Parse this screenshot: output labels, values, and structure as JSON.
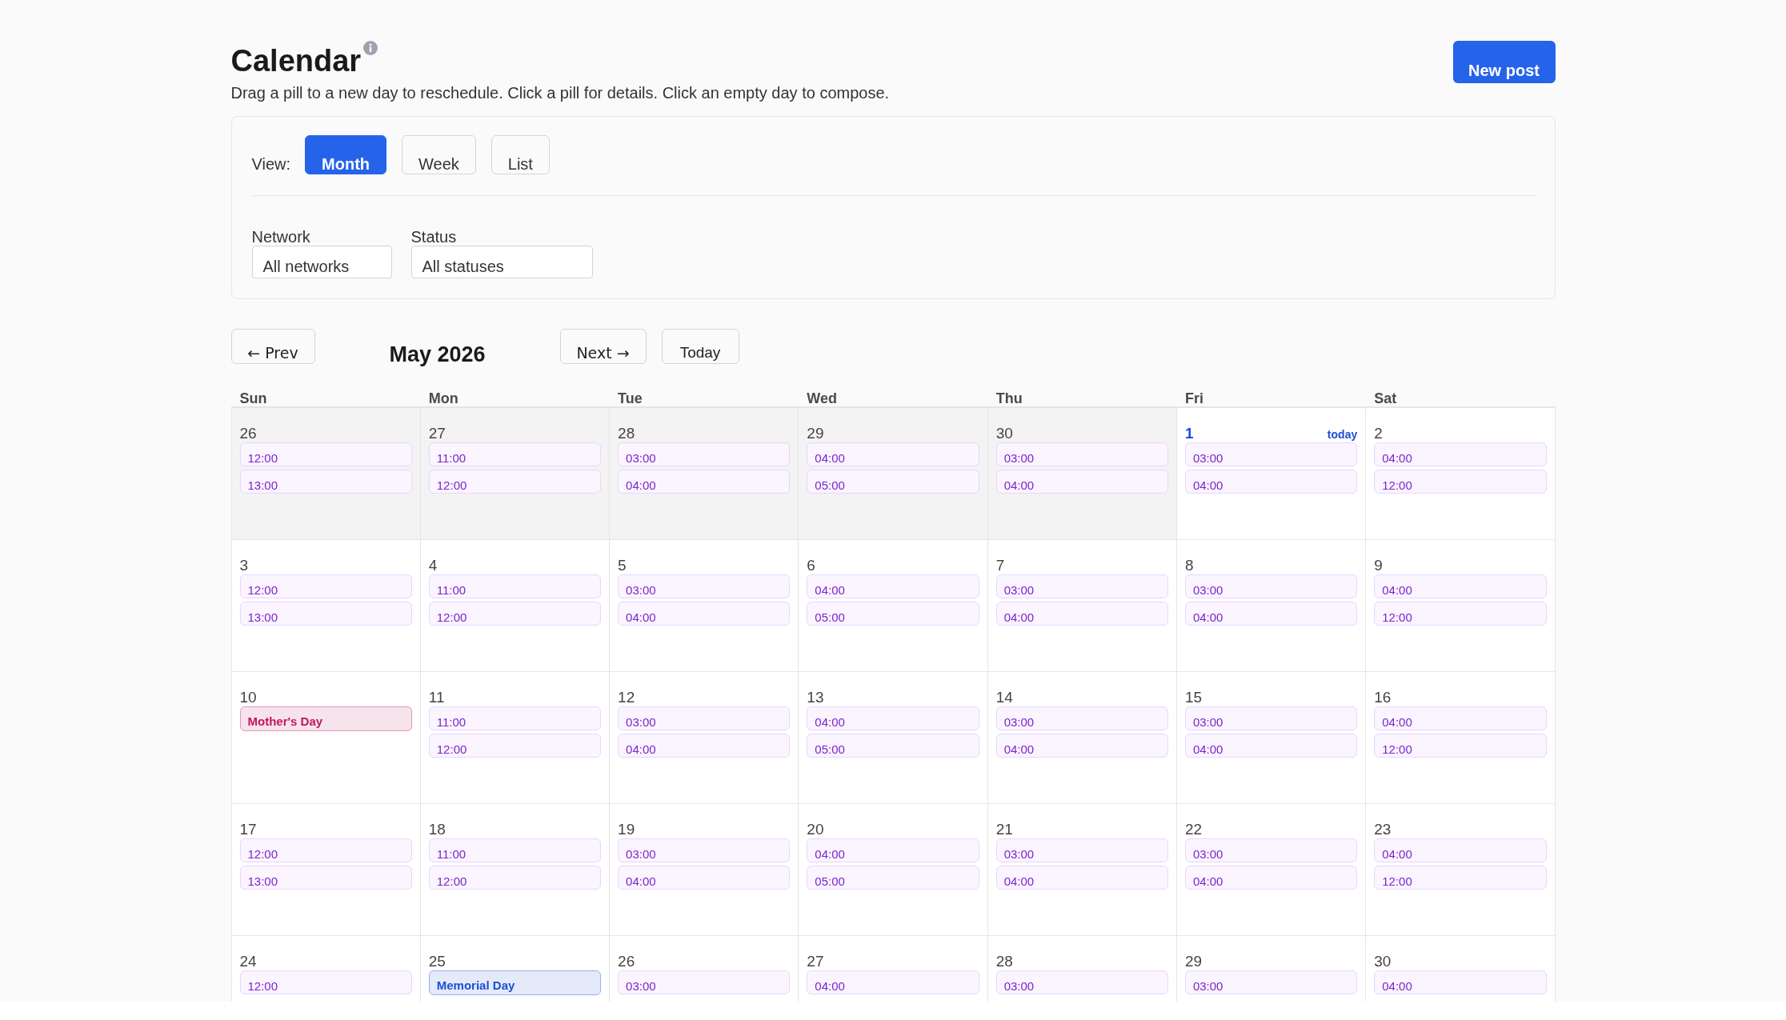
{
  "header": {
    "title": "Calendar",
    "subtitle": "Drag a pill to a new day to reschedule. Click a pill for details. Click an empty day to compose.",
    "new_post_button": "New post"
  },
  "filters": {
    "view_label": "View:",
    "views": [
      {
        "label": "Month",
        "selected": true
      },
      {
        "label": "Week",
        "selected": false
      },
      {
        "label": "List",
        "selected": false
      }
    ],
    "selects": [
      {
        "label": "Network",
        "value": "All networks"
      },
      {
        "label": "Status",
        "value": "All statuses"
      }
    ]
  },
  "navigation": {
    "prev_button": "← Prev",
    "month_title": "May 2026",
    "next_button": "Next →",
    "today_button": "Today"
  },
  "calendar": {
    "weekdays": [
      "Sun",
      "Mon",
      "Tue",
      "Wed",
      "Thu",
      "Fri",
      "Sat"
    ],
    "today_label": "today",
    "weeks": [
      [
        {
          "date": "26",
          "in_month": false,
          "today": false,
          "events": [
            {
              "kind": "post",
              "label": "12:00"
            },
            {
              "kind": "post",
              "label": "13:00"
            }
          ]
        },
        {
          "date": "27",
          "in_month": false,
          "today": false,
          "events": [
            {
              "kind": "post",
              "label": "11:00"
            },
            {
              "kind": "post",
              "label": "12:00"
            }
          ]
        },
        {
          "date": "28",
          "in_month": false,
          "today": false,
          "events": [
            {
              "kind": "post",
              "label": "03:00"
            },
            {
              "kind": "post",
              "label": "04:00"
            }
          ]
        },
        {
          "date": "29",
          "in_month": false,
          "today": false,
          "events": [
            {
              "kind": "post",
              "label": "04:00"
            },
            {
              "kind": "post",
              "label": "05:00"
            }
          ]
        },
        {
          "date": "30",
          "in_month": false,
          "today": false,
          "events": [
            {
              "kind": "post",
              "label": "03:00"
            },
            {
              "kind": "post",
              "label": "04:00"
            }
          ]
        },
        {
          "date": "1",
          "in_month": true,
          "today": true,
          "events": [
            {
              "kind": "post",
              "label": "03:00"
            },
            {
              "kind": "post",
              "label": "04:00"
            }
          ]
        },
        {
          "date": "2",
          "in_month": true,
          "today": false,
          "events": [
            {
              "kind": "post",
              "label": "04:00"
            },
            {
              "kind": "post",
              "label": "12:00"
            }
          ]
        }
      ],
      [
        {
          "date": "3",
          "in_month": true,
          "today": false,
          "events": [
            {
              "kind": "post",
              "label": "12:00"
            },
            {
              "kind": "post",
              "label": "13:00"
            }
          ]
        },
        {
          "date": "4",
          "in_month": true,
          "today": false,
          "events": [
            {
              "kind": "post",
              "label": "11:00"
            },
            {
              "kind": "post",
              "label": "12:00"
            }
          ]
        },
        {
          "date": "5",
          "in_month": true,
          "today": false,
          "events": [
            {
              "kind": "post",
              "label": "03:00"
            },
            {
              "kind": "post",
              "label": "04:00"
            }
          ]
        },
        {
          "date": "6",
          "in_month": true,
          "today": false,
          "events": [
            {
              "kind": "post",
              "label": "04:00"
            },
            {
              "kind": "post",
              "label": "05:00"
            }
          ]
        },
        {
          "date": "7",
          "in_month": true,
          "today": false,
          "events": [
            {
              "kind": "post",
              "label": "03:00"
            },
            {
              "kind": "post",
              "label": "04:00"
            }
          ]
        },
        {
          "date": "8",
          "in_month": true,
          "today": false,
          "events": [
            {
              "kind": "post",
              "label": "03:00"
            },
            {
              "kind": "post",
              "label": "04:00"
            }
          ]
        },
        {
          "date": "9",
          "in_month": true,
          "today": false,
          "events": [
            {
              "kind": "post",
              "label": "04:00"
            },
            {
              "kind": "post",
              "label": "12:00"
            }
          ]
        }
      ],
      [
        {
          "date": "10",
          "in_month": true,
          "today": false,
          "events": [
            {
              "kind": "holiday",
              "label": "Mother's Day",
              "color": "#be185d"
            }
          ]
        },
        {
          "date": "11",
          "in_month": true,
          "today": false,
          "events": [
            {
              "kind": "post",
              "label": "11:00"
            },
            {
              "kind": "post",
              "label": "12:00"
            }
          ]
        },
        {
          "date": "12",
          "in_month": true,
          "today": false,
          "events": [
            {
              "kind": "post",
              "label": "03:00"
            },
            {
              "kind": "post",
              "label": "04:00"
            }
          ]
        },
        {
          "date": "13",
          "in_month": true,
          "today": false,
          "events": [
            {
              "kind": "post",
              "label": "04:00"
            },
            {
              "kind": "post",
              "label": "05:00"
            }
          ]
        },
        {
          "date": "14",
          "in_month": true,
          "today": false,
          "events": [
            {
              "kind": "post",
              "label": "03:00"
            },
            {
              "kind": "post",
              "label": "04:00"
            }
          ]
        },
        {
          "date": "15",
          "in_month": true,
          "today": false,
          "events": [
            {
              "kind": "post",
              "label": "03:00"
            },
            {
              "kind": "post",
              "label": "04:00"
            }
          ]
        },
        {
          "date": "16",
          "in_month": true,
          "today": false,
          "events": [
            {
              "kind": "post",
              "label": "04:00"
            },
            {
              "kind": "post",
              "label": "12:00"
            }
          ]
        }
      ],
      [
        {
          "date": "17",
          "in_month": true,
          "today": false,
          "events": [
            {
              "kind": "post",
              "label": "12:00"
            },
            {
              "kind": "post",
              "label": "13:00"
            }
          ]
        },
        {
          "date": "18",
          "in_month": true,
          "today": false,
          "events": [
            {
              "kind": "post",
              "label": "11:00"
            },
            {
              "kind": "post",
              "label": "12:00"
            }
          ]
        },
        {
          "date": "19",
          "in_month": true,
          "today": false,
          "events": [
            {
              "kind": "post",
              "label": "03:00"
            },
            {
              "kind": "post",
              "label": "04:00"
            }
          ]
        },
        {
          "date": "20",
          "in_month": true,
          "today": false,
          "events": [
            {
              "kind": "post",
              "label": "04:00"
            },
            {
              "kind": "post",
              "label": "05:00"
            }
          ]
        },
        {
          "date": "21",
          "in_month": true,
          "today": false,
          "events": [
            {
              "kind": "post",
              "label": "03:00"
            },
            {
              "kind": "post",
              "label": "04:00"
            }
          ]
        },
        {
          "date": "22",
          "in_month": true,
          "today": false,
          "events": [
            {
              "kind": "post",
              "label": "03:00"
            },
            {
              "kind": "post",
              "label": "04:00"
            }
          ]
        },
        {
          "date": "23",
          "in_month": true,
          "today": false,
          "events": [
            {
              "kind": "post",
              "label": "04:00"
            },
            {
              "kind": "post",
              "label": "12:00"
            }
          ]
        }
      ],
      [
        {
          "date": "24",
          "in_month": true,
          "today": false,
          "events": [
            {
              "kind": "post",
              "label": "12:00"
            }
          ]
        },
        {
          "date": "25",
          "in_month": true,
          "today": false,
          "events": [
            {
              "kind": "holiday",
              "label": "Memorial Day",
              "color": "#1d4ed8"
            }
          ]
        },
        {
          "date": "26",
          "in_month": true,
          "today": false,
          "events": [
            {
              "kind": "post",
              "label": "03:00"
            }
          ]
        },
        {
          "date": "27",
          "in_month": true,
          "today": false,
          "events": [
            {
              "kind": "post",
              "label": "04:00"
            }
          ]
        },
        {
          "date": "28",
          "in_month": true,
          "today": false,
          "events": [
            {
              "kind": "post",
              "label": "03:00"
            }
          ]
        },
        {
          "date": "29",
          "in_month": true,
          "today": false,
          "events": [
            {
              "kind": "post",
              "label": "03:00"
            }
          ]
        },
        {
          "date": "30",
          "in_month": true,
          "today": false,
          "events": [
            {
              "kind": "post",
              "label": "04:00"
            }
          ]
        }
      ]
    ]
  }
}
